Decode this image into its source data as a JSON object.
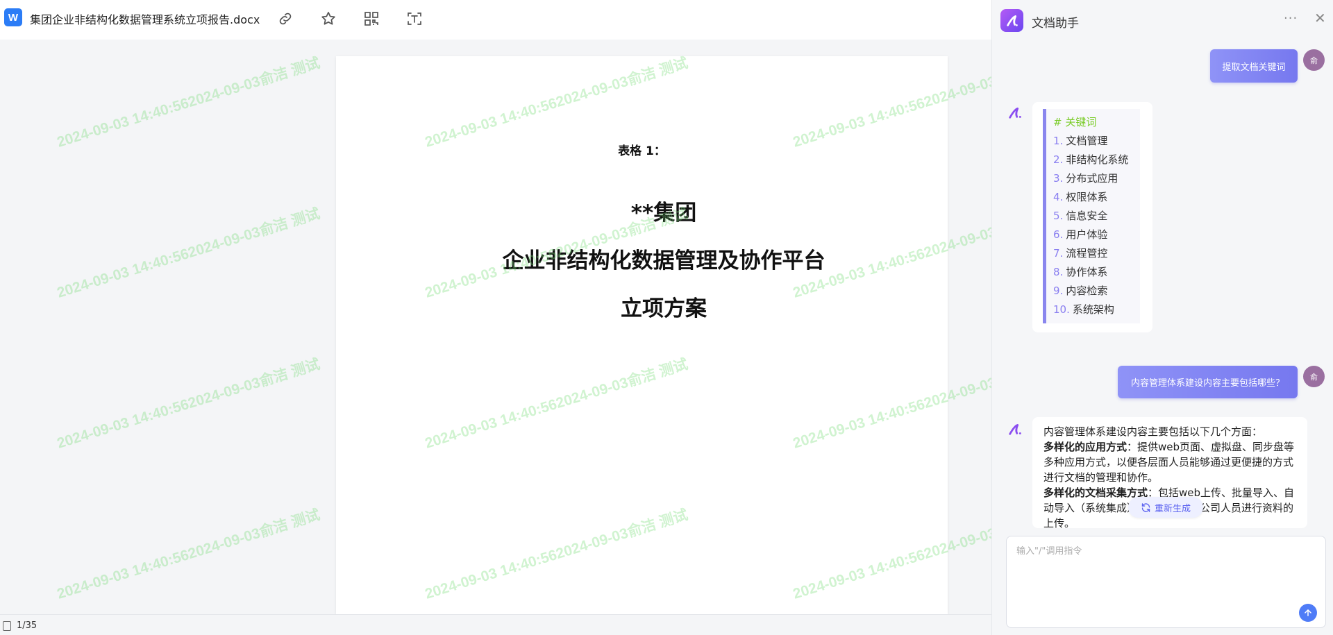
{
  "file": {
    "badge": "W",
    "title": "集团企业非结构化数据管理系统立项报告.docx"
  },
  "toolbar": {
    "icons": [
      "link-icon",
      "star-icon",
      "qr-code-icon",
      "text-recognition-icon"
    ]
  },
  "document": {
    "table_label": "表格 1：",
    "heading_line1": "**集团",
    "heading_line2": "企业非结构化数据管理及协作平台",
    "heading_line3": "立项方案",
    "watermark_text": "2024-09-03 14:40:562024-09-03俞洁 测试"
  },
  "status": {
    "page": "1/35"
  },
  "assistant": {
    "title": "文档助手",
    "more_label": "···",
    "close_label": "✕",
    "avatar_text": "俞",
    "user_msg1": "提取文档关键词",
    "user_msg2": "内容管理体系建设内容主要包括哪些？",
    "keywords_heading": "# 关键词",
    "keywords": [
      {
        "num": "1.",
        "text": "文档管理"
      },
      {
        "num": "2.",
        "text": "非结构化系统"
      },
      {
        "num": "3.",
        "text": "分布式应用"
      },
      {
        "num": "4.",
        "text": "权限体系"
      },
      {
        "num": "5.",
        "text": "信息安全"
      },
      {
        "num": "6.",
        "text": "用户体验"
      },
      {
        "num": "7.",
        "text": "流程管控"
      },
      {
        "num": "8.",
        "text": "协作体系"
      },
      {
        "num": "9.",
        "text": "内容检索"
      },
      {
        "num": "10.",
        "text": "系统架构"
      }
    ],
    "answer_intro": "内容管理体系建设内容主要包括以下几个方面：",
    "answer_p1_bold": "多样化的应用方式",
    "answer_p1_text": "：提供web页面、虚拟盘、同步盘等多种应用方式，以便各层面人员能够通过更便捷的方式进行文档的管理和协作。",
    "answer_p2_bold": "多样化的文档采集方式",
    "answer_p2_text": "：包括web上传、批量导入、自动导入（系统集成）等方式，方便公司人员进行资料的上传。",
    "regenerate_label": "重新生成",
    "input_placeholder": "输入\"/\"调用指令"
  }
}
